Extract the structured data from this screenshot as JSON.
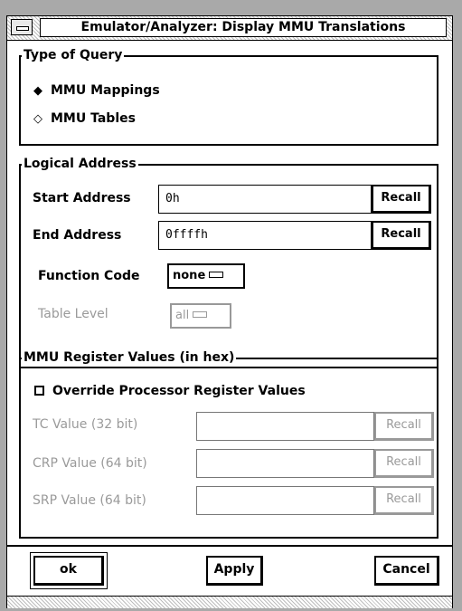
{
  "window": {
    "title": "Emulator/Analyzer: Display MMU Translations"
  },
  "type_of_query": {
    "label": "Type of Query",
    "options": [
      {
        "label": "MMU Mappings",
        "selected": true,
        "icon": "diamond-filled-icon"
      },
      {
        "label": "MMU Tables",
        "selected": false,
        "icon": "diamond-empty-icon"
      }
    ]
  },
  "logical_address": {
    "label": "Logical Address",
    "start": {
      "label": "Start Address",
      "value": "0h",
      "recall": "Recall"
    },
    "end": {
      "label": "End Address",
      "value": "0ffffh",
      "recall": "Recall"
    },
    "function_code": {
      "label": "Function Code",
      "value": "none"
    },
    "table_level": {
      "label": "Table Level",
      "value": "all"
    }
  },
  "mmu_registers": {
    "label": "MMU Register Values (in hex)",
    "override": {
      "label": "Override Processor Register Values",
      "checked": false
    },
    "tc": {
      "label": "TC Value (32 bit)",
      "value": "",
      "recall": "Recall"
    },
    "crp": {
      "label": "CRP Value (64 bit)",
      "value": "",
      "recall": "Recall"
    },
    "srp": {
      "label": "SRP Value (64 bit)",
      "value": "",
      "recall": "Recall"
    }
  },
  "buttons": {
    "ok": "ok",
    "apply": "Apply",
    "cancel": "Cancel"
  },
  "colors": {
    "background": "#ffffff",
    "disabled_text": "#9a9a9a",
    "border": "#000000"
  }
}
